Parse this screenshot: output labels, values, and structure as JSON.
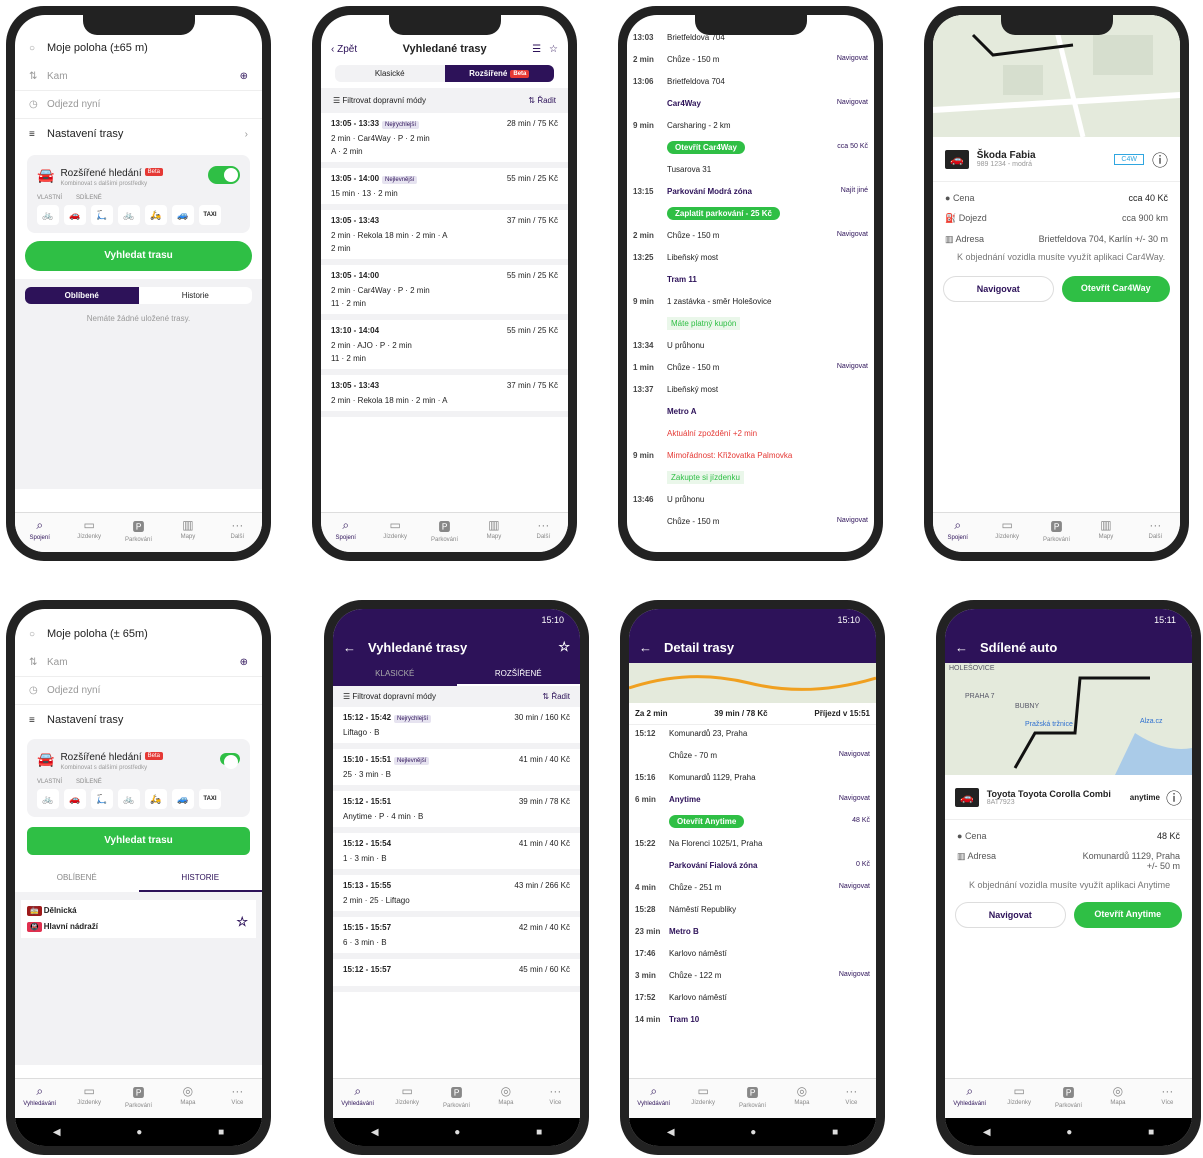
{
  "p1": {
    "loc": "Moje poloha (±65 m)",
    "to": "Kam",
    "when": "Odjezd nyní",
    "settings": "Nastavení trasy",
    "adv": "Rozšířené hledání",
    "beta": "Beta",
    "adv_sub": "Kombinovat s dalšími prostředky",
    "own": "VLASTNÍ",
    "shared": "SDÍLENÉ",
    "search": "Vyhledat trasu",
    "fav": "Oblíbené",
    "hist": "Historie",
    "empty": "Nemáte žádné uložené trasy."
  },
  "tabs": [
    "Spojení",
    "Jízdenky",
    "Parkování",
    "Mapy",
    "Další"
  ],
  "tabs_and": [
    "Vyhledávání",
    "Jízdenky",
    "Parkování",
    "Mapa",
    "Více"
  ],
  "p2": {
    "back": "Zpět",
    "title": "Vyhledané trasy",
    "seg": [
      "Klasické",
      "Rozšířené"
    ],
    "beta": "Beta",
    "filter": "Filtrovat dopravní módy",
    "sort": "Řadit",
    "results": [
      {
        "time": "13:05 - 13:33",
        "tag": "Nejrychlejší",
        "meta": "28 min / 75 Kč",
        "l1": "2 min · Car4Way · P · 2 min",
        "l2": "A · 2 min"
      },
      {
        "time": "13:05 - 14:00",
        "tag": "Nejlevnější",
        "meta": "55 min / 25 Kč",
        "l1": "15 min · 13 · 2 min",
        "l2": ""
      },
      {
        "time": "13:05 - 13:43",
        "tag": "",
        "meta": "37 min / 75 Kč",
        "l1": "2 min · Rekola 18 min · 2 min · A",
        "l2": "2 min"
      },
      {
        "time": "13:05 - 14:00",
        "tag": "",
        "meta": "55 min / 25 Kč",
        "l1": "2 min · Car4Way · P · 2 min",
        "l2": "11 · 2 min"
      },
      {
        "time": "13:10 - 14:04",
        "tag": "",
        "meta": "55 min / 25 Kč",
        "l1": "2 min · AJO · P · 2 min",
        "l2": "11 · 2 min"
      },
      {
        "time": "13:05 - 13:43",
        "tag": "",
        "meta": "37 min / 75 Kč",
        "l1": "2 min · Rekola 18 min · 2 min · A",
        "l2": ""
      }
    ]
  },
  "p3": {
    "steps": [
      {
        "t": "13:03",
        "d": "Brietfeldova 704",
        "r": ""
      },
      {
        "t": "2 min",
        "d": "Chůze - 150 m",
        "r": "Navigovat"
      },
      {
        "t": "13:06",
        "d": "Brietfeldova 704",
        "r": ""
      },
      {
        "t": "",
        "d": "Car4Way",
        "r": "Navigovat"
      },
      {
        "t": "9 min",
        "d": "Carsharing - 2 km",
        "r": ""
      },
      {
        "t": "",
        "d": "Otevřít Car4Way",
        "r": "cca 50 Kč"
      },
      {
        "t": "",
        "d": "Tusarova 31",
        "r": ""
      },
      {
        "t": "13:15",
        "d": "Parkování  Modrá zóna",
        "r": "Najít jiné"
      },
      {
        "t": "",
        "d": "Zaplatit parkování - 25 Kč",
        "r": ""
      },
      {
        "t": "2 min",
        "d": "Chůze - 150 m",
        "r": "Navigovat"
      },
      {
        "t": "13:25",
        "d": "Libeňský most",
        "r": ""
      },
      {
        "t": "",
        "d": "Tram 11",
        "r": ""
      },
      {
        "t": "9 min",
        "d": "1 zastávka - směr Holešovice",
        "r": ""
      },
      {
        "t": "",
        "d": "Máte platný kupón",
        "r": ""
      },
      {
        "t": "13:34",
        "d": "U průhonu",
        "r": ""
      },
      {
        "t": "1 min",
        "d": "Chůze - 150 m",
        "r": "Navigovat"
      },
      {
        "t": "13:37",
        "d": "Libeňský most",
        "r": ""
      },
      {
        "t": "",
        "d": "Metro A",
        "r": ""
      },
      {
        "t": "",
        "d": "Aktuální zpoždění +2 min",
        "r": ""
      },
      {
        "t": "9 min",
        "d": "Mimořádnost: Křižovatka Palmovka",
        "r": ""
      },
      {
        "t": "",
        "d": "Zakupte si jízdenku",
        "r": ""
      },
      {
        "t": "13:46",
        "d": "U průhonu",
        "r": ""
      },
      {
        "t": "",
        "d": "Chůze - 150 m",
        "r": "Navigovat"
      }
    ]
  },
  "p4": {
    "car": "Škoda Fabia",
    "plate": "989 1234 - modrá",
    "brand": "C4W",
    "price_l": "Cena",
    "price": "cca 40 Kč",
    "range_l": "Dojezd",
    "range": "cca 900 km",
    "addr_l": "Adresa",
    "addr": "Brietfeldova 704, Karlín +/- 30 m",
    "note": "K objednání vozidla musíte využít aplikaci Car4Way.",
    "nav": "Navigovat",
    "open": "Otevřít Car4Way"
  },
  "p5": {
    "loc": "Moje poloha (± 65m)",
    "to": "Kam",
    "when": "Odjezd nyní",
    "settings": "Nastavení trasy",
    "adv": "Rozšířené hledání",
    "adv_sub": "Kombinovat s dalšími prostředky",
    "own": "VLASTNÍ",
    "shared": "SDÍLENÉ",
    "search": "Vyhledat trasu",
    "fav": "OBLÍBENÉ",
    "hist": "HISTORIE",
    "h1": "Dělnická",
    "h2": "Hlavní nádraží"
  },
  "p6": {
    "status": "15:10",
    "title": "Vyhledané trasy",
    "seg": [
      "KLASICKÉ",
      "ROZŠÍŘENÉ"
    ],
    "filter": "Filtrovat dopravní módy",
    "sort": "Řadit",
    "results": [
      {
        "time": "15:12 - 15:42",
        "tag": "Nejrychlejší",
        "meta": "30 min / 160 Kč",
        "l1": "Liftago · B"
      },
      {
        "time": "15:10 - 15:51",
        "tag": "Nejlevnější",
        "meta": "41 min / 40 Kč",
        "l1": "25 · 3 min · B"
      },
      {
        "time": "15:12 - 15:51",
        "tag": "",
        "meta": "39 min / 78 Kč",
        "l1": "Anytime · P · 4 min · B"
      },
      {
        "time": "15:12 - 15:54",
        "tag": "",
        "meta": "41 min / 40 Kč",
        "l1": "1 · 3 min · B"
      },
      {
        "time": "15:13 - 15:55",
        "tag": "",
        "meta": "43 min / 266 Kč",
        "l1": "2 min · 25 · Liftago"
      },
      {
        "time": "15:15 - 15:57",
        "tag": "",
        "meta": "42 min / 40 Kč",
        "l1": "6 · 3 min · B"
      },
      {
        "time": "15:12 - 15:57",
        "tag": "",
        "meta": "45 min / 60 Kč",
        "l1": ""
      }
    ]
  },
  "p7": {
    "status": "15:10",
    "title": "Detail trasy",
    "za": "Za 2 min",
    "dur": "39 min / 78 Kč",
    "arr": "Příjezd v 15:51",
    "steps": [
      {
        "t": "15:12",
        "d": "Komunardů 23, Praha",
        "r": ""
      },
      {
        "t": "",
        "d": "Chůze - 70 m",
        "r": "Navigovat"
      },
      {
        "t": "15:16",
        "d": "Komunardů 1129, Praha",
        "r": ""
      },
      {
        "t": "6 min",
        "d": "Anytime",
        "r": "Navigovat"
      },
      {
        "t": "",
        "d": "Otevřít Anytime",
        "r": "48 Kč"
      },
      {
        "t": "15:22",
        "d": "Na Florenci 1025/1, Praha",
        "r": ""
      },
      {
        "t": "",
        "d": "Parkování  Fialová zóna",
        "r": "0 Kč"
      },
      {
        "t": "4 min",
        "d": "Chůze - 251 m",
        "r": "Navigovat"
      },
      {
        "t": "15:28",
        "d": "Náměstí Republiky",
        "r": ""
      },
      {
        "t": "23 min",
        "d": "Metro B",
        "r": ""
      },
      {
        "t": "17:46",
        "d": "Karlovo náměstí",
        "r": ""
      },
      {
        "t": "3 min",
        "d": "Chůze - 122 m",
        "r": "Navigovat"
      },
      {
        "t": "17:52",
        "d": "Karlovo náměstí",
        "r": ""
      },
      {
        "t": "14 min",
        "d": "Tram 10",
        "r": ""
      }
    ]
  },
  "p8": {
    "status": "15:11",
    "title": "Sdílené auto",
    "car": "Toyota Toyota Corolla Combi",
    "plate": "8AT7923",
    "brand": "anytime",
    "price_l": "Cena",
    "price": "48 Kč",
    "addr_l": "Adresa",
    "addr": "Komunardů 1129, Praha +/- 50 m",
    "note": "K objednání vozidla musíte využít aplikaci Anytime",
    "nav": "Navigovat",
    "open": "Otevřít Anytime",
    "map_labels": [
      "PRAHA 7",
      "BUBNY",
      "Pražská tržnice",
      "Alza.cz",
      "HOLEŠOVICE"
    ]
  },
  "colors": {
    "brand": "#2d1259",
    "green": "#2fbf45",
    "red": "#e53935"
  }
}
